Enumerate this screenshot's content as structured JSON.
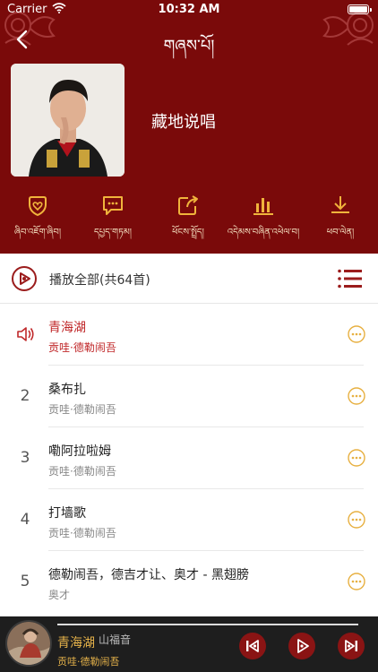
{
  "status": {
    "carrier": "Carrier",
    "time": "10:32 AM"
  },
  "nav": {
    "title": "གཞས་པོ།"
  },
  "artist": {
    "name": "藏地说唱"
  },
  "actions": [
    {
      "label": "ཞིབ་འཇོག་ཞིབ།",
      "icon": "heart-badge-icon"
    },
    {
      "label": "དཔྱད་གཏམ།",
      "icon": "comment-icon"
    },
    {
      "label": "ཕོངས་སྤྲོད།",
      "icon": "share-icon"
    },
    {
      "label": "འདེམས་བཞིན་འཕེལ་བ།",
      "icon": "chart-bars-icon"
    },
    {
      "label": "ཕབ་ལེན།",
      "icon": "download-icon"
    }
  ],
  "playall": {
    "label": "播放全部(共64首)"
  },
  "songs": [
    {
      "index": "",
      "title": "青海湖",
      "artist": "贡哇·德勒闹吾",
      "playing": true
    },
    {
      "index": "2",
      "title": "桑布扎",
      "artist": "贡哇·德勒闹吾",
      "playing": false
    },
    {
      "index": "3",
      "title": "嘞阿拉啦姆",
      "artist": "贡哇·德勒闹吾",
      "playing": false
    },
    {
      "index": "4",
      "title": "打墙歌",
      "artist": "贡哇·德勒闹吾",
      "playing": false
    },
    {
      "index": "5",
      "title": "德勒闹吾，德吉才让、奥才 - 黑翅膀",
      "artist": "奥才",
      "playing": false
    }
  ],
  "player": {
    "title": "青海湖",
    "next_title": "山福音",
    "artist": "贡哇·德勒闹吾",
    "progress": 1.0
  },
  "colors": {
    "header_bg": "#7a0a0a",
    "accent_red": "#c0282a",
    "gold": "#e6b34a",
    "player_bg": "#1e1e1e"
  }
}
